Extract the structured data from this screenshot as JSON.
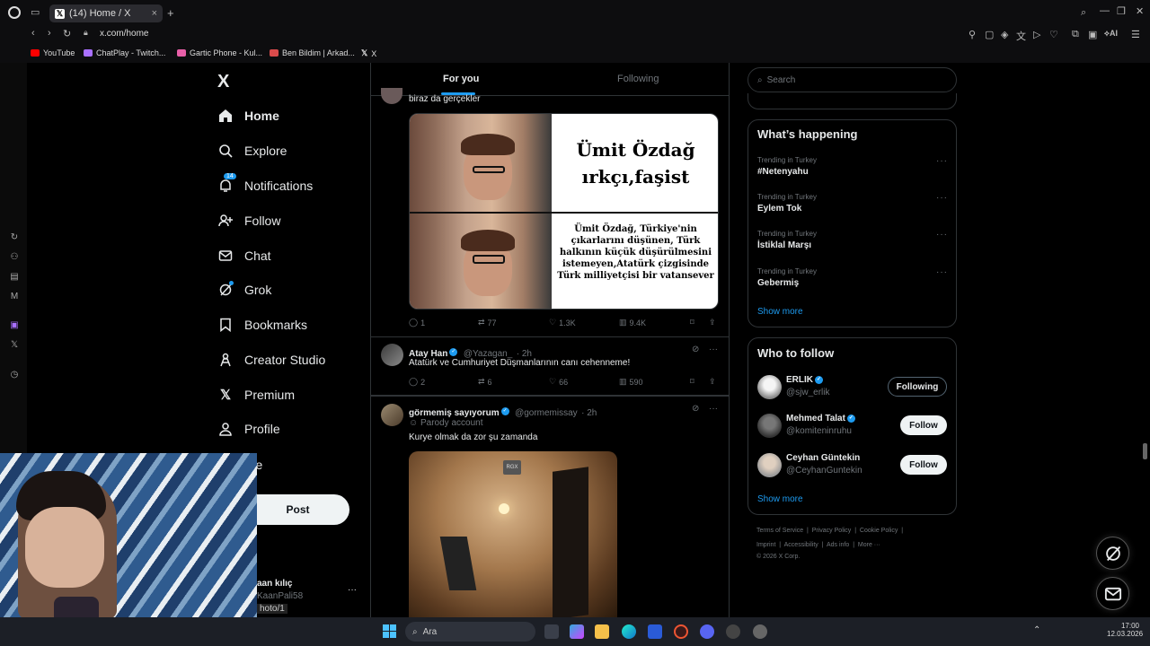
{
  "browser": {
    "tab_title": "(14) Home / X",
    "tab_close": "×",
    "new_tab": "+",
    "url": "x.com/home",
    "bookmarks": [
      "YouTube",
      "ChatPlay - Twitch...",
      "Gartic Phone - Kul...",
      "Ben Bildim | Arkad...",
      "X"
    ],
    "toolbar_ai_label": "AI"
  },
  "x_nav": {
    "logo": "X",
    "items": [
      {
        "label": "Home",
        "icon": "home-icon"
      },
      {
        "label": "Explore",
        "icon": "search-icon"
      },
      {
        "label": "Notifications",
        "icon": "bell-icon",
        "badge": "14"
      },
      {
        "label": "Follow",
        "icon": "add-user-icon"
      },
      {
        "label": "Chat",
        "icon": "mail-icon"
      },
      {
        "label": "Grok",
        "icon": "grok-icon"
      },
      {
        "label": "Bookmarks",
        "icon": "bookmark-icon"
      },
      {
        "label": "Creator Studio",
        "icon": "creator-icon"
      },
      {
        "label": "Premium",
        "icon": "x-icon"
      },
      {
        "label": "Profile",
        "icon": "person-icon"
      },
      {
        "label": "ore",
        "icon": "more-icon"
      }
    ],
    "post_button": "Post",
    "account_name": "aan kılıç",
    "account_handle": "KaanPali58",
    "account_more": "···",
    "status_url": "hoto/1"
  },
  "feed": {
    "tabs": [
      "For you",
      "Following"
    ],
    "tweet1": {
      "text": "biraz da gerçekler",
      "meme_top": [
        "Ümit Özdağ",
        "ırkçı,faşist"
      ],
      "meme_bottom": "Ümit Özdağ, Türkiye'nin çıkarlarını düşünen, Türk halkının küçük düşürülmesini istemeyen,Atatürk çizgisinde Türk milliyetçisi bir vatansever",
      "replies": "1",
      "reposts": "77",
      "likes": "1.3K",
      "views": "9.4K"
    },
    "tweet2": {
      "name": "Atay Han",
      "handle": "@Yazagan_",
      "time": "· 2h",
      "text": "Atatürk ve Cumhuriyet Düşmanlarının canı cehenneme!",
      "replies": "2",
      "reposts": "6",
      "likes": "66",
      "views": "590"
    },
    "tweet3": {
      "name": "görmemiş sayıyorum",
      "handle": "@gormemissay",
      "time": "· 2h",
      "parody": "Parody account",
      "text": "Kurye olmak da zor şu zamanda",
      "video_badge": "RGX"
    },
    "more_dots": "···"
  },
  "sidebar": {
    "search_placeholder": "Search",
    "whats_happening_title": "What’s happening",
    "trends": [
      {
        "meta": "Trending in Turkey",
        "name": "#Netenyahu"
      },
      {
        "meta": "Trending in Turkey",
        "name": "Eylem Tok"
      },
      {
        "meta": "Trending in Turkey",
        "name": "İstiklal Marşı"
      },
      {
        "meta": "Trending in Turkey",
        "name": "Gebermiş"
      }
    ],
    "trend_more": "···",
    "show_more": "Show more",
    "who_to_follow_title": "Who to follow",
    "suggestions": [
      {
        "name": "ERLIK",
        "handle": "@sjw_erlik",
        "button": "Following"
      },
      {
        "name": "Mehmed Talat",
        "handle": "@komiteninruhu",
        "button": "Follow"
      },
      {
        "name": "Ceyhan Güntekin",
        "handle": "@CeyhanGuntekin",
        "button": "Follow"
      }
    ],
    "footer": {
      "links_row1": [
        "Terms of Service",
        "|",
        "Privacy Policy",
        "|",
        "Cookie Policy",
        "|"
      ],
      "links_row2": [
        "Imprint",
        "|",
        "Accessibility",
        "|",
        "Ads info",
        "|",
        "More ···"
      ],
      "copyright": "© 2026 X Corp."
    }
  },
  "taskbar": {
    "search_placeholder": "Ara",
    "time": "17:00",
    "date": "12.03.2026"
  },
  "colors": {
    "accent": "#1d9bf0",
    "background": "#000000",
    "border": "#2f3336",
    "secondary_text": "#71767b"
  }
}
